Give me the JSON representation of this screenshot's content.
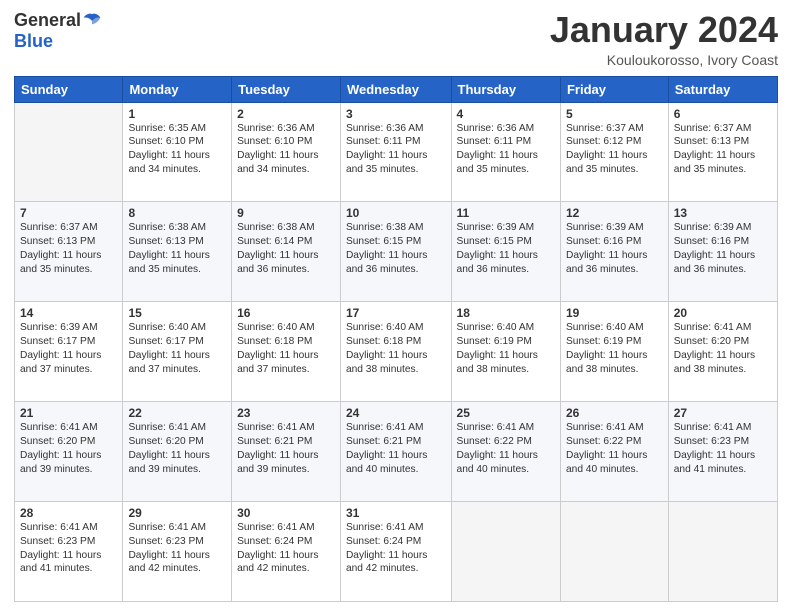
{
  "logo": {
    "general": "General",
    "blue": "Blue"
  },
  "header": {
    "month": "January 2024",
    "location": "Kouloukorosso, Ivory Coast"
  },
  "weekdays": [
    "Sunday",
    "Monday",
    "Tuesday",
    "Wednesday",
    "Thursday",
    "Friday",
    "Saturday"
  ],
  "weeks": [
    [
      {
        "day": "",
        "info": ""
      },
      {
        "day": "1",
        "info": "Sunrise: 6:35 AM\nSunset: 6:10 PM\nDaylight: 11 hours\nand 34 minutes."
      },
      {
        "day": "2",
        "info": "Sunrise: 6:36 AM\nSunset: 6:10 PM\nDaylight: 11 hours\nand 34 minutes."
      },
      {
        "day": "3",
        "info": "Sunrise: 6:36 AM\nSunset: 6:11 PM\nDaylight: 11 hours\nand 35 minutes."
      },
      {
        "day": "4",
        "info": "Sunrise: 6:36 AM\nSunset: 6:11 PM\nDaylight: 11 hours\nand 35 minutes."
      },
      {
        "day": "5",
        "info": "Sunrise: 6:37 AM\nSunset: 6:12 PM\nDaylight: 11 hours\nand 35 minutes."
      },
      {
        "day": "6",
        "info": "Sunrise: 6:37 AM\nSunset: 6:13 PM\nDaylight: 11 hours\nand 35 minutes."
      }
    ],
    [
      {
        "day": "7",
        "info": ""
      },
      {
        "day": "8",
        "info": "Sunrise: 6:38 AM\nSunset: 6:13 PM\nDaylight: 11 hours\nand 35 minutes."
      },
      {
        "day": "9",
        "info": "Sunrise: 6:38 AM\nSunset: 6:14 PM\nDaylight: 11 hours\nand 36 minutes."
      },
      {
        "day": "10",
        "info": "Sunrise: 6:38 AM\nSunset: 6:15 PM\nDaylight: 11 hours\nand 36 minutes."
      },
      {
        "day": "11",
        "info": "Sunrise: 6:39 AM\nSunset: 6:15 PM\nDaylight: 11 hours\nand 36 minutes."
      },
      {
        "day": "12",
        "info": "Sunrise: 6:39 AM\nSunset: 6:16 PM\nDaylight: 11 hours\nand 36 minutes."
      },
      {
        "day": "13",
        "info": "Sunrise: 6:39 AM\nSunset: 6:16 PM\nDaylight: 11 hours\nand 36 minutes."
      }
    ],
    [
      {
        "day": "14",
        "info": ""
      },
      {
        "day": "15",
        "info": "Sunrise: 6:40 AM\nSunset: 6:17 PM\nDaylight: 11 hours\nand 37 minutes."
      },
      {
        "day": "16",
        "info": "Sunrise: 6:40 AM\nSunset: 6:18 PM\nDaylight: 11 hours\nand 37 minutes."
      },
      {
        "day": "17",
        "info": "Sunrise: 6:40 AM\nSunset: 6:18 PM\nDaylight: 11 hours\nand 38 minutes."
      },
      {
        "day": "18",
        "info": "Sunrise: 6:40 AM\nSunset: 6:19 PM\nDaylight: 11 hours\nand 38 minutes."
      },
      {
        "day": "19",
        "info": "Sunrise: 6:40 AM\nSunset: 6:19 PM\nDaylight: 11 hours\nand 38 minutes."
      },
      {
        "day": "20",
        "info": "Sunrise: 6:41 AM\nSunset: 6:20 PM\nDaylight: 11 hours\nand 38 minutes."
      }
    ],
    [
      {
        "day": "21",
        "info": ""
      },
      {
        "day": "22",
        "info": "Sunrise: 6:41 AM\nSunset: 6:20 PM\nDaylight: 11 hours\nand 39 minutes."
      },
      {
        "day": "23",
        "info": "Sunrise: 6:41 AM\nSunset: 6:21 PM\nDaylight: 11 hours\nand 39 minutes."
      },
      {
        "day": "24",
        "info": "Sunrise: 6:41 AM\nSunset: 6:21 PM\nDaylight: 11 hours\nand 40 minutes."
      },
      {
        "day": "25",
        "info": "Sunrise: 6:41 AM\nSunset: 6:22 PM\nDaylight: 11 hours\nand 40 minutes."
      },
      {
        "day": "26",
        "info": "Sunrise: 6:41 AM\nSunset: 6:22 PM\nDaylight: 11 hours\nand 40 minutes."
      },
      {
        "day": "27",
        "info": "Sunrise: 6:41 AM\nSunset: 6:23 PM\nDaylight: 11 hours\nand 41 minutes."
      }
    ],
    [
      {
        "day": "28",
        "info": "Sunrise: 6:41 AM\nSunset: 6:23 PM\nDaylight: 11 hours\nand 41 minutes."
      },
      {
        "day": "29",
        "info": "Sunrise: 6:41 AM\nSunset: 6:23 PM\nDaylight: 11 hours\nand 42 minutes."
      },
      {
        "day": "30",
        "info": "Sunrise: 6:41 AM\nSunset: 6:24 PM\nDaylight: 11 hours\nand 42 minutes."
      },
      {
        "day": "31",
        "info": "Sunrise: 6:41 AM\nSunset: 6:24 PM\nDaylight: 11 hours\nand 42 minutes."
      },
      {
        "day": "",
        "info": ""
      },
      {
        "day": "",
        "info": ""
      },
      {
        "day": "",
        "info": ""
      }
    ]
  ]
}
